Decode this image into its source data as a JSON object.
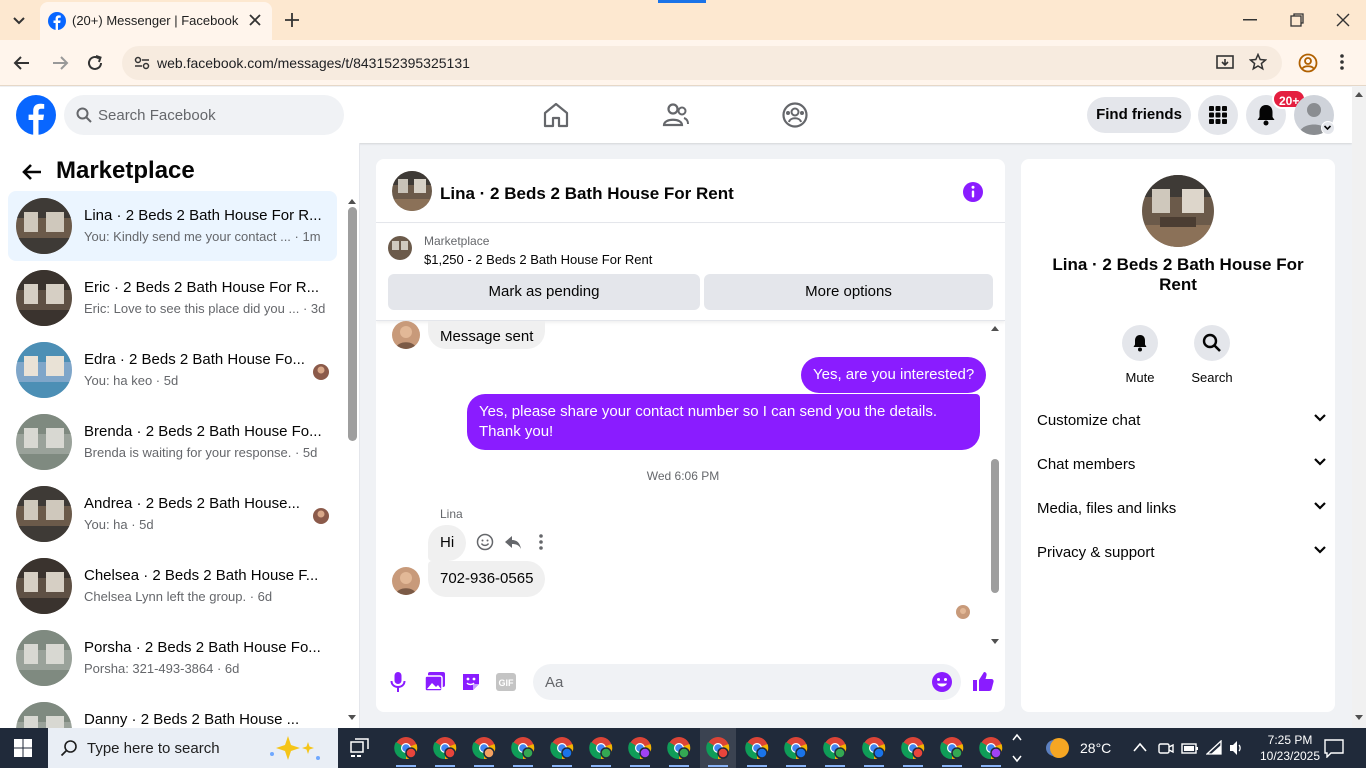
{
  "browser": {
    "tab_title": "(20+) Messenger | Facebook",
    "url": "web.facebook.com/messages/t/843152395325131"
  },
  "fb": {
    "search_placeholder": "Search Facebook",
    "find_friends": "Find friends",
    "notification_count": "20+"
  },
  "left": {
    "title": "Marketplace",
    "conversations": [
      {
        "name": "Lina · 2 Beds 2 Bath House For R...",
        "preview": "You: Kindly send me your contact ... · 1m",
        "active": true
      },
      {
        "name": "Eric · 2 Beds 2 Bath House For R...",
        "preview": "Eric: Love to see this place did you ... · 3d"
      },
      {
        "name": "Edra · 2 Beds 2 Bath House Fo...",
        "preview": "You: ha keo · 5d"
      },
      {
        "name": "Brenda · 2 Beds 2 Bath House Fo...",
        "preview": "Brenda is waiting for your response. · 5d"
      },
      {
        "name": "Andrea · 2 Beds 2 Bath House...",
        "preview": "You: ha · 5d"
      },
      {
        "name": "Chelsea · 2 Beds 2 Bath House F...",
        "preview": "Chelsea Lynn left the group. · 6d"
      },
      {
        "name": "Porsha · 2 Beds 2 Bath House Fo...",
        "preview": "Porsha: 321-493-3864 · 6d"
      },
      {
        "name": "Danny · 2 Beds 2 Bath House ...",
        "preview": ""
      }
    ]
  },
  "chat": {
    "title": "Lina · 2 Beds 2 Bath House For Rent",
    "marketplace_label": "Marketplace",
    "listing": "$1,250 - 2 Beds 2 Bath House For Rent",
    "mark_pending": "Mark as pending",
    "more_options": "More options",
    "messages": {
      "sent_notice": "Message sent",
      "out1": "Yes, are you interested?",
      "out2": "Yes, please share your contact number so I can send you the details. Thank you!",
      "timestamp": "Wed 6:06 PM",
      "sender": "Lina",
      "in1": "Hi",
      "in2": "702-936-0565"
    },
    "composer_placeholder": "Aa"
  },
  "info": {
    "name": "Lina · 2 Beds 2 Bath House For Rent",
    "mute": "Mute",
    "search": "Search",
    "sections": [
      "Customize chat",
      "Chat members",
      "Media, files and links",
      "Privacy & support"
    ]
  },
  "taskbar": {
    "search_text": "Type here to search",
    "temperature": "28°C",
    "time": "7:25 PM",
    "date": "10/23/2025"
  },
  "colors": {
    "accent": "#8a1cff",
    "fb_blue": "#0866ff",
    "badge": "#e41e3f"
  }
}
